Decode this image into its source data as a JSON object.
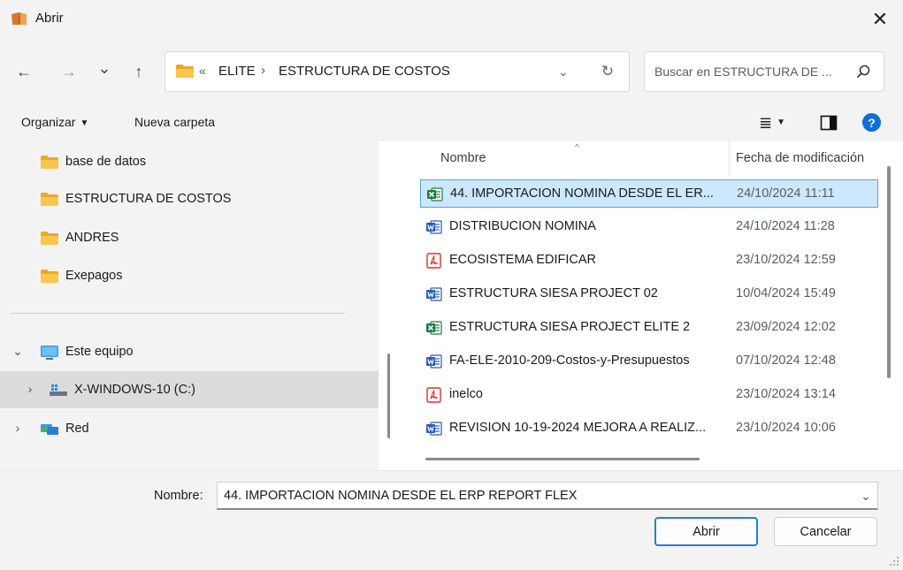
{
  "window": {
    "title": "Abrir",
    "app_icon": "books-icon",
    "close_glyph": "✕"
  },
  "navigation": {
    "back": "←",
    "forward": "→",
    "recent": "⌄",
    "up": "↑",
    "address": {
      "overflow": "«",
      "breadcrumbs": [
        "ELITE",
        "ESTRUCTURA DE COSTOS"
      ],
      "separator": "›",
      "dropdown_glyph": "⌄",
      "refresh_glyph": "↻"
    },
    "search": {
      "placeholder": "Buscar en ESTRUCTURA DE ..."
    }
  },
  "toolbar": {
    "organize": "Organizar",
    "organize_caret": "▼",
    "new_folder": "Nueva carpeta",
    "view_glyph": "≣",
    "view_caret": "▼",
    "help": "?"
  },
  "sidebar": {
    "folders": [
      {
        "label": "base de datos"
      },
      {
        "label": "ESTRUCTURA DE COSTOS"
      },
      {
        "label": "ANDRES"
      },
      {
        "label": "Exepagos"
      }
    ],
    "this_pc": {
      "label": "Este equipo",
      "chevron": "⌄"
    },
    "drive": {
      "label": "X-WINDOWS-10 (C:)",
      "chevron": "›"
    },
    "network": {
      "label": "Red",
      "chevron": "›"
    }
  },
  "file_list": {
    "sort_glyph": "^",
    "columns": {
      "name": "Nombre",
      "modified": "Fecha de modificación"
    },
    "files": [
      {
        "name": "44. IMPORTACION NOMINA DESDE EL ER...",
        "date": "24/10/2024 11:11",
        "type": "excel",
        "selected": true
      },
      {
        "name": "DISTRIBUCION NOMINA",
        "date": "24/10/2024 11:28",
        "type": "word",
        "selected": false
      },
      {
        "name": "ECOSISTEMA EDIFICAR",
        "date": "23/10/2024 12:59",
        "type": "pdf",
        "selected": false
      },
      {
        "name": "ESTRUCTURA SIESA PROJECT 02",
        "date": "10/04/2024 15:49",
        "type": "word",
        "selected": false
      },
      {
        "name": "ESTRUCTURA SIESA PROJECT ELITE 2",
        "date": "23/09/2024 12:02",
        "type": "excel",
        "selected": false
      },
      {
        "name": "FA-ELE-2010-209-Costos-y-Presupuestos",
        "date": "07/10/2024 12:48",
        "type": "word",
        "selected": false
      },
      {
        "name": "inelco",
        "date": "23/10/2024 13:14",
        "type": "pdf",
        "selected": false
      },
      {
        "name": "REVISION 10-19-2024 MEJORA A REALIZ...",
        "date": "23/10/2024 10:06",
        "type": "word",
        "selected": false
      }
    ]
  },
  "footer": {
    "filename_label": "Nombre:",
    "filename_value": "44. IMPORTACION NOMINA DESDE EL ERP REPORT FLEX",
    "dropdown_glyph": "⌄",
    "open_button": "Abrir",
    "cancel_button": "Cancelar"
  },
  "colors": {
    "chrome_bg": "#f3f3f3",
    "selection_bg": "#cce8ff",
    "selection_border": "#4fa3e0",
    "accent": "#2a7bd4",
    "folder": "#f2c04b",
    "excel": "#1d7a45",
    "word": "#2b5bb8",
    "pdf": "#d5352a"
  }
}
